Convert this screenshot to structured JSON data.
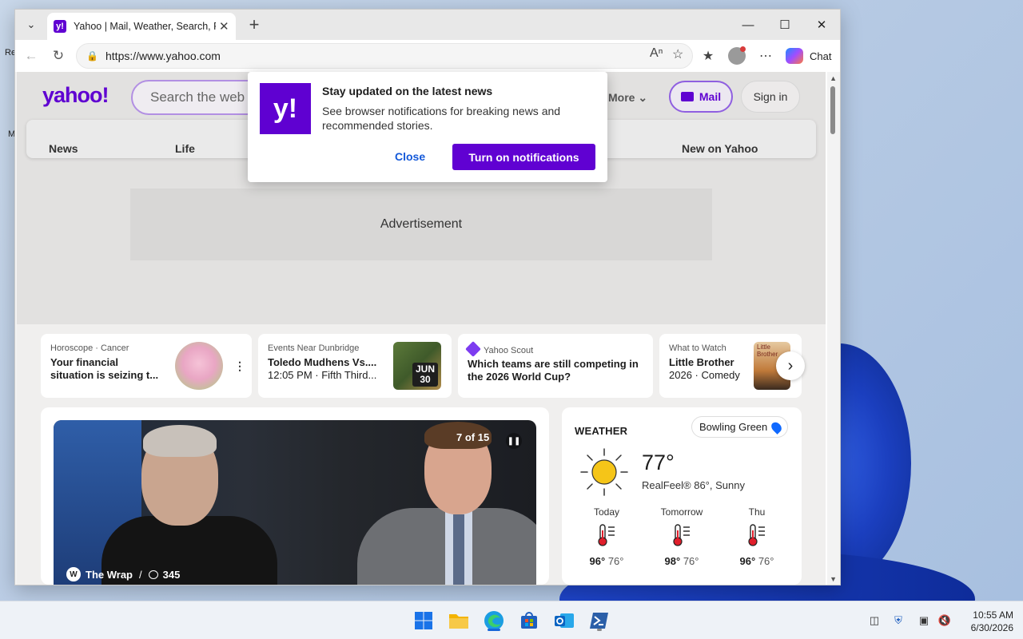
{
  "desktop": {
    "fragment_top": "Re",
    "fragment_mid": "M"
  },
  "browser": {
    "tab_title": "Yahoo | Mail, Weather, Search, Politics, News, Finance, Sports & Videos",
    "url": "https://www.yahoo.com",
    "copilot_label": "Chat"
  },
  "yahoo": {
    "logo": "yahoo!",
    "search_placeholder": "Search the web",
    "more_label": "More",
    "mail_label": "Mail",
    "signin_label": "Sign in",
    "nav": [
      "News",
      "Life",
      "New on Yahoo"
    ],
    "ad_label": "Advertisement"
  },
  "popup": {
    "logo": "y!",
    "title": "Stay updated on the latest news",
    "body": "See browser notifications for breaking news and recommended stories.",
    "close_label": "Close",
    "cta_label": "Turn on notifications"
  },
  "cards": [
    {
      "kicker": "Horoscope · Cancer",
      "title": "Your financial situation is seizing t..."
    },
    {
      "kicker": "Events Near Dunbridge",
      "title": "Toledo Mudhens Vs....",
      "sub": "12:05 PM · Fifth Third...",
      "badge_month": "JUN",
      "badge_day": "30"
    },
    {
      "kicker": "Yahoo Scout",
      "title": "Which teams are still competing in the 2026 World Cup?"
    },
    {
      "kicker": "What to Watch",
      "title": "Little Brother",
      "sub": "2026 · Comedy",
      "thumb_text": "Little Brother"
    }
  ],
  "hero": {
    "slide_count": "7 of 15",
    "source_logo": "W",
    "source": "The Wrap",
    "comments": "345"
  },
  "weather": {
    "title": "WEATHER",
    "location": "Bowling Green",
    "temp": "77°",
    "realfeel": "RealFeel® 86°, Sunny",
    "forecast": [
      {
        "label": "Today",
        "high": "96°",
        "low": "76°"
      },
      {
        "label": "Tomorrow",
        "high": "98°",
        "low": "76°"
      },
      {
        "label": "Thu",
        "high": "96°",
        "low": "76°"
      }
    ]
  },
  "taskbar": {
    "time": "10:55 AM",
    "date": "6/30/2026"
  },
  "colors": {
    "yahoo_purple": "#6001d2",
    "link_blue": "#1459d9"
  }
}
